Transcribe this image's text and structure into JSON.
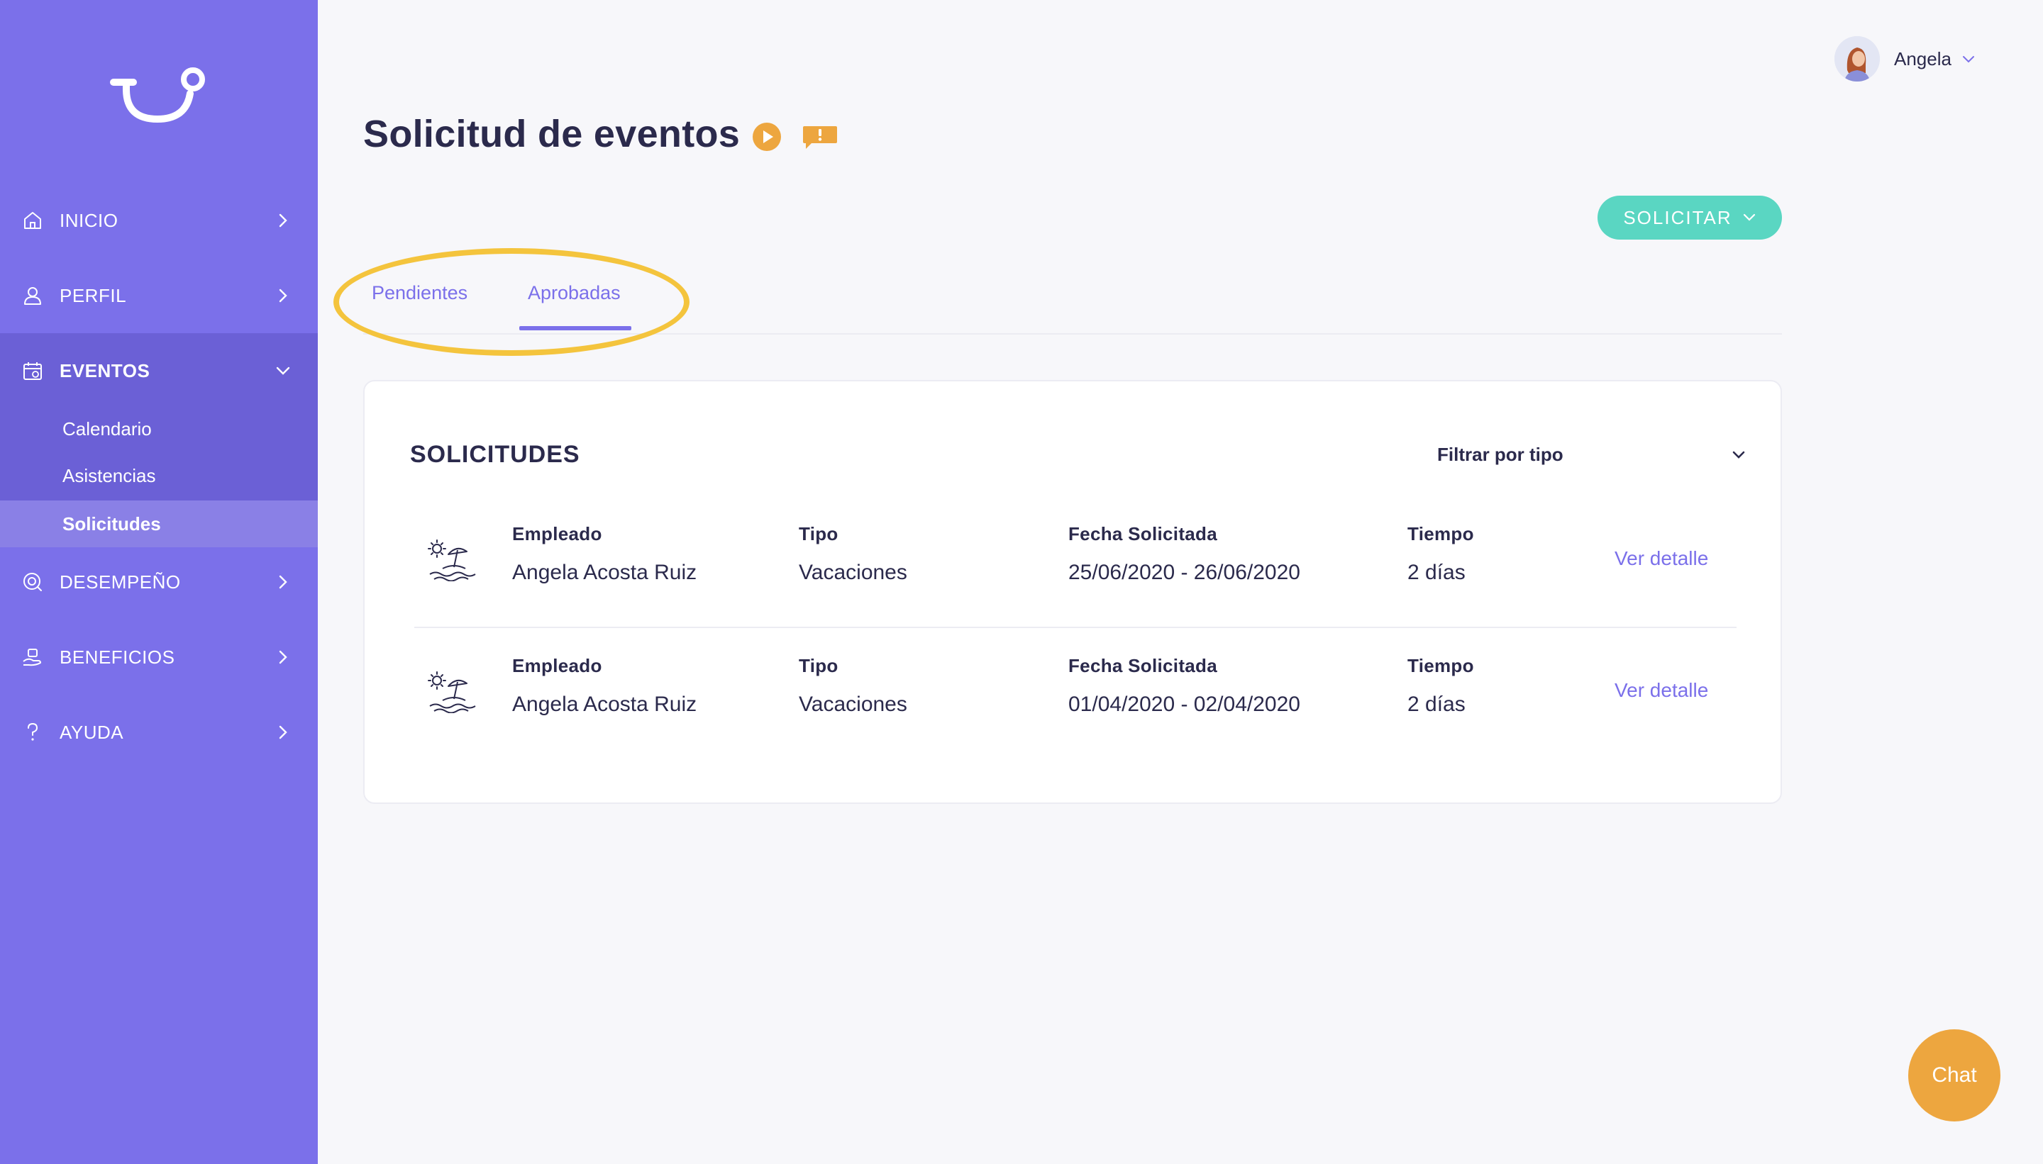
{
  "sidebar": {
    "logo": "tu-logo-icon",
    "items": [
      {
        "label": "INICIO",
        "icon": "home-icon"
      },
      {
        "label": "PERFIL",
        "icon": "user-icon"
      },
      {
        "label": "EVENTOS",
        "icon": "calendar-icon",
        "expanded": true
      },
      {
        "label": "DESEMPEÑO",
        "icon": "performance-icon"
      },
      {
        "label": "BENEFICIOS",
        "icon": "benefits-icon"
      },
      {
        "label": "AYUDA",
        "icon": "help-icon"
      }
    ],
    "subitems": [
      {
        "label": "Calendario"
      },
      {
        "label": "Asistencias"
      },
      {
        "label": "Solicitudes",
        "selected": true
      }
    ]
  },
  "header": {
    "user_name": "Angela"
  },
  "page": {
    "title": "Solicitud de eventos",
    "solicitar_label": "SOLICITAR",
    "tabs": [
      {
        "label": "Pendientes",
        "active": false
      },
      {
        "label": "Aprobadas",
        "active": true
      }
    ]
  },
  "card": {
    "title": "SOLICITUDES",
    "filter_label": "Filtrar por tipo",
    "rows": [
      {
        "icon": "beach-vacation-icon",
        "employee_head": "Empleado",
        "employee": "Angela Acosta Ruiz",
        "type_head": "Tipo",
        "type": "Vacaciones",
        "date_head": "Fecha Solicitada",
        "date": "25/06/2020 - 26/06/2020",
        "time_head": "Tiempo",
        "time": "2 días",
        "link": "Ver detalle"
      },
      {
        "icon": "beach-vacation-icon",
        "employee_head": "Empleado",
        "employee": "Angela Acosta Ruiz",
        "type_head": "Tipo",
        "type": "Vacaciones",
        "date_head": "Fecha Solicitada",
        "date": "01/04/2020 - 02/04/2020",
        "time_head": "Tiempo",
        "time": "2 días",
        "link": "Ver detalle"
      }
    ]
  },
  "chat": {
    "label": "Chat"
  },
  "colors": {
    "sidebar": "#7b70ea",
    "sidebar_active": "#6b60d6",
    "accent": "#7b70ea",
    "solicitar": "#5ad6c2",
    "chat": "#eda63f",
    "highlight": "#f4c43d"
  }
}
